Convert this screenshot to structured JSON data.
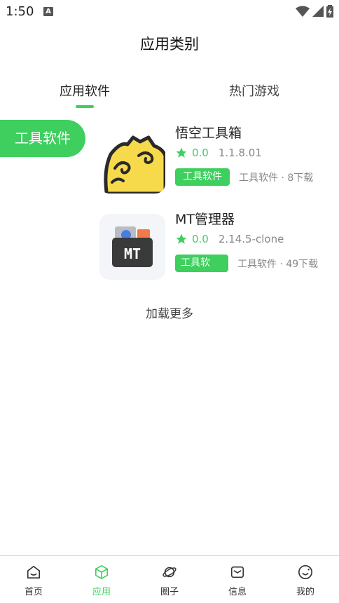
{
  "status_bar": {
    "time": "1:50",
    "notification_glyph": "A"
  },
  "header": {
    "title": "应用类别"
  },
  "tabs": [
    {
      "label": "应用软件",
      "active": true
    },
    {
      "label": "热门游戏",
      "active": false
    }
  ],
  "category": {
    "label": "工具软件"
  },
  "apps": [
    {
      "name": "悟空工具箱",
      "rating": "0.0",
      "version": "1.1.8.01",
      "tag": "工具软件",
      "meta": "工具软件 · 8下载",
      "icon": "wukong-toolbox-icon"
    },
    {
      "name": "MT管理器",
      "rating": "0.0",
      "version": "2.14.5-clone",
      "tag": "工具软",
      "meta": "工具软件 · 49下载",
      "icon": "mt-manager-icon",
      "icon_text": "MT"
    }
  ],
  "load_more": "加载更多",
  "bottom_nav": [
    {
      "label": "首页",
      "icon": "home-icon"
    },
    {
      "label": "应用",
      "icon": "cube-icon",
      "active": true
    },
    {
      "label": "圈子",
      "icon": "planet-icon"
    },
    {
      "label": "信息",
      "icon": "message-icon"
    },
    {
      "label": "我的",
      "icon": "smile-icon"
    }
  ],
  "colors": {
    "accent": "#3ecf5e",
    "text_secondary": "#888888"
  }
}
